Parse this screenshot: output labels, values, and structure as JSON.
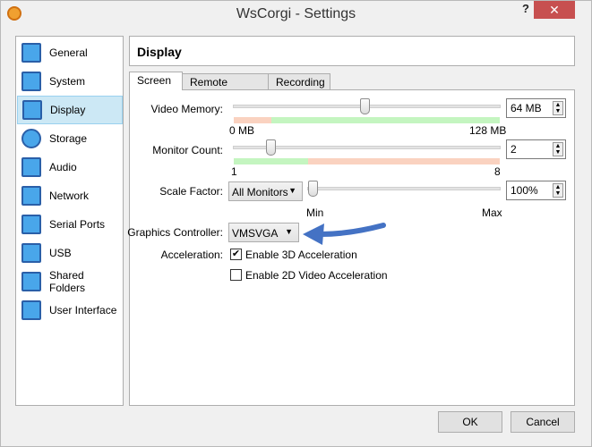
{
  "window": {
    "title": "WsCorgi - Settings",
    "help": "?",
    "close": "✕"
  },
  "sidebar": {
    "items": [
      {
        "label": "General"
      },
      {
        "label": "System"
      },
      {
        "label": "Display",
        "selected": true
      },
      {
        "label": "Storage"
      },
      {
        "label": "Audio"
      },
      {
        "label": "Network"
      },
      {
        "label": "Serial Ports"
      },
      {
        "label": "USB"
      },
      {
        "label": "Shared Folders"
      },
      {
        "label": "User Interface"
      }
    ]
  },
  "header": {
    "title": "Display"
  },
  "tabs": [
    {
      "label": "Screen",
      "active": true
    },
    {
      "label": "Remote Display"
    },
    {
      "label": "Recording"
    }
  ],
  "screen": {
    "video_memory": {
      "label": "Video Memory:",
      "value": "64 MB",
      "min": "0 MB",
      "max": "128 MB",
      "fraction": 0.5
    },
    "monitor_count": {
      "label": "Monitor Count:",
      "value": "2",
      "min": "1",
      "max": "8",
      "fraction": 0.143
    },
    "scale_factor": {
      "label": "Scale Factor:",
      "monitors": "All Monitors",
      "value": "100%",
      "min": "Min",
      "max": "Max",
      "fraction": 0
    },
    "graphics_controller": {
      "label": "Graphics Controller:",
      "value": "VMSVGA"
    },
    "acceleration": {
      "label": "Acceleration:",
      "enable_3d": {
        "label": "Enable 3D Acceleration",
        "checked": true
      },
      "enable_2d": {
        "label": "Enable 2D Video Acceleration",
        "checked": false
      }
    }
  },
  "buttons": {
    "ok": "OK",
    "cancel": "Cancel"
  },
  "colors": {
    "accent": "#3c78c8",
    "range_ok": "#c4f5c0",
    "range_bad": "#fad2c0",
    "close": "#c75050"
  }
}
